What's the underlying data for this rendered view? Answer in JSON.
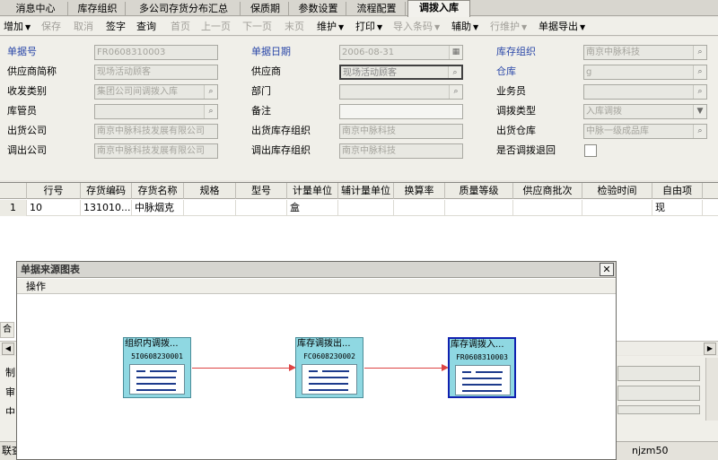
{
  "tabs": [
    "消息中心",
    "库存组织",
    "多公司存货分布汇总",
    "保质期",
    "参数设置",
    "流程配置",
    "调拨入库"
  ],
  "toolbar": {
    "add": "增加",
    "save": "保存",
    "cancel": "取消",
    "sign": "签字",
    "query": "查询",
    "first": "首页",
    "prev": "上一页",
    "next": "下一页",
    "last": "末页",
    "maintain": "维护",
    "print": "打印",
    "import_barcode": "导入条码",
    "assist": "辅助",
    "line_maint": "行维护",
    "export": "单据导出"
  },
  "form": {
    "doc_no_label": "单据号",
    "doc_no": "FR0608310003",
    "doc_date_label": "单据日期",
    "doc_date": "2006-08-31",
    "inv_org_label": "库存组织",
    "inv_org": "南京中脉科技",
    "supplier_short_label": "供应商简称",
    "supplier_short": "现场活动顾客",
    "supplier_label": "供应商",
    "supplier": "现场活动顾客",
    "warehouse_label": "仓库",
    "warehouse": "g",
    "rs_type_label": "收发类别",
    "rs_type": "集团公司间调拨入库",
    "dept_label": "部门",
    "dept": "",
    "clerk_label": "业务员",
    "clerk": "",
    "keeper_label": "库管员",
    "keeper": "",
    "remark_label": "备注",
    "remark": "",
    "transfer_type_label": "调拨类型",
    "transfer_type": "入库调拨",
    "out_company_label": "出货公司",
    "out_company": "南京中脉科技发展有限公司",
    "out_inv_org_label": "出货库存组织",
    "out_inv_org": "南京中脉科技",
    "out_warehouse_label": "出货仓库",
    "out_warehouse": "中脉一级成品库",
    "transfer_company_label": "调出公司",
    "transfer_company": "南京中脉科技发展有限公司",
    "transfer_inv_org_label": "调出库存组织",
    "transfer_inv_org": "南京中脉科技",
    "is_return_label": "是否调拨退回"
  },
  "grid": {
    "headers": [
      "行号",
      "存货编码",
      "存货名称",
      "规格",
      "型号",
      "计量单位",
      "辅计量单位",
      "换算率",
      "质量等级",
      "供应商批次",
      "检验时间",
      "自由项"
    ],
    "rows": [
      {
        "idx": "1",
        "line": "10",
        "code": "131010...",
        "name": "中脉烟克",
        "spec": "",
        "model": "",
        "unit": "盒",
        "aux": "",
        "rate": "",
        "quality": "",
        "batch": "",
        "inspect": "",
        "free": "现"
      }
    ]
  },
  "lower": {
    "l1": "制",
    "l2": "审",
    "l3": "中",
    "left_stub": "合",
    "status_left": "联查",
    "user": "njzm50"
  },
  "dialog": {
    "title": "单据来源图表",
    "menu_op": "操作",
    "nodes": [
      {
        "title": "组织内调拨...",
        "id": "5I0608230001"
      },
      {
        "title": "库存调拨出...",
        "id": "FC0608230002"
      },
      {
        "title": "库存调拨入...",
        "id": "FR0608310003"
      }
    ]
  },
  "icons": {
    "search": "magnifier-icon",
    "calendar": "calendar-icon",
    "dropdown": "chevron-down-icon",
    "close": "close-icon"
  },
  "colors": {
    "label_blue": "#2a47a8",
    "node_fill": "#8fd8e2",
    "link_red": "#dd4444",
    "selected_border": "#1021b0"
  }
}
